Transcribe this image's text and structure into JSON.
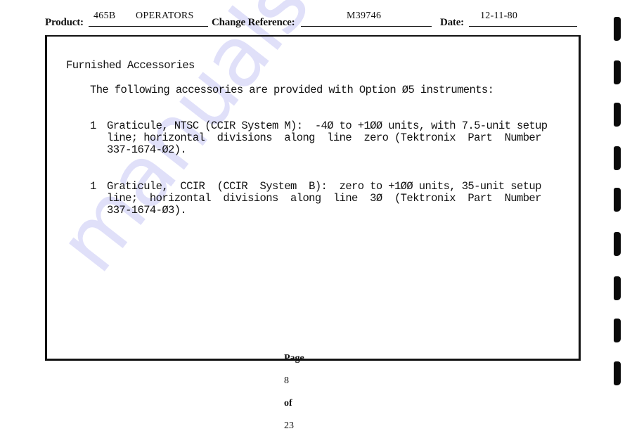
{
  "header": {
    "product_label": "Product:",
    "product_value_model": "465B",
    "product_value_type": "OPERATORS",
    "change_reference_label": "Change Reference:",
    "change_reference_value": "M39746",
    "date_label": "Date:",
    "date_value": "12-11-80"
  },
  "body": {
    "section_title": "Furnished Accessories",
    "intro": "The following accessories are provided with Option Ø5 instruments:",
    "items": [
      {
        "qty": "1",
        "lines": [
          "Graticule, NTSC (CCIR System M):  -4Ø to +1ØØ units, with 7.5-unit setup",
          "line; horizontal  divisions  along  line  zero (Tektronix  Part  Number",
          "337-1674-Ø2)."
        ]
      },
      {
        "qty": "1",
        "lines": [
          "Graticule,  CCIR  (CCIR  System  B):  zero to +1ØØ units, 35-unit setup",
          "line;  horizontal  divisions  along  line  3Ø  (Tektronix  Part  Number",
          "337-1674-Ø3)."
        ]
      }
    ]
  },
  "footer": {
    "page_label": "Page",
    "page_number": "8",
    "of_label": "of",
    "total_pages": "23"
  },
  "watermark": {
    "text": "manualshive.com",
    "color": "#d6d6f8"
  }
}
